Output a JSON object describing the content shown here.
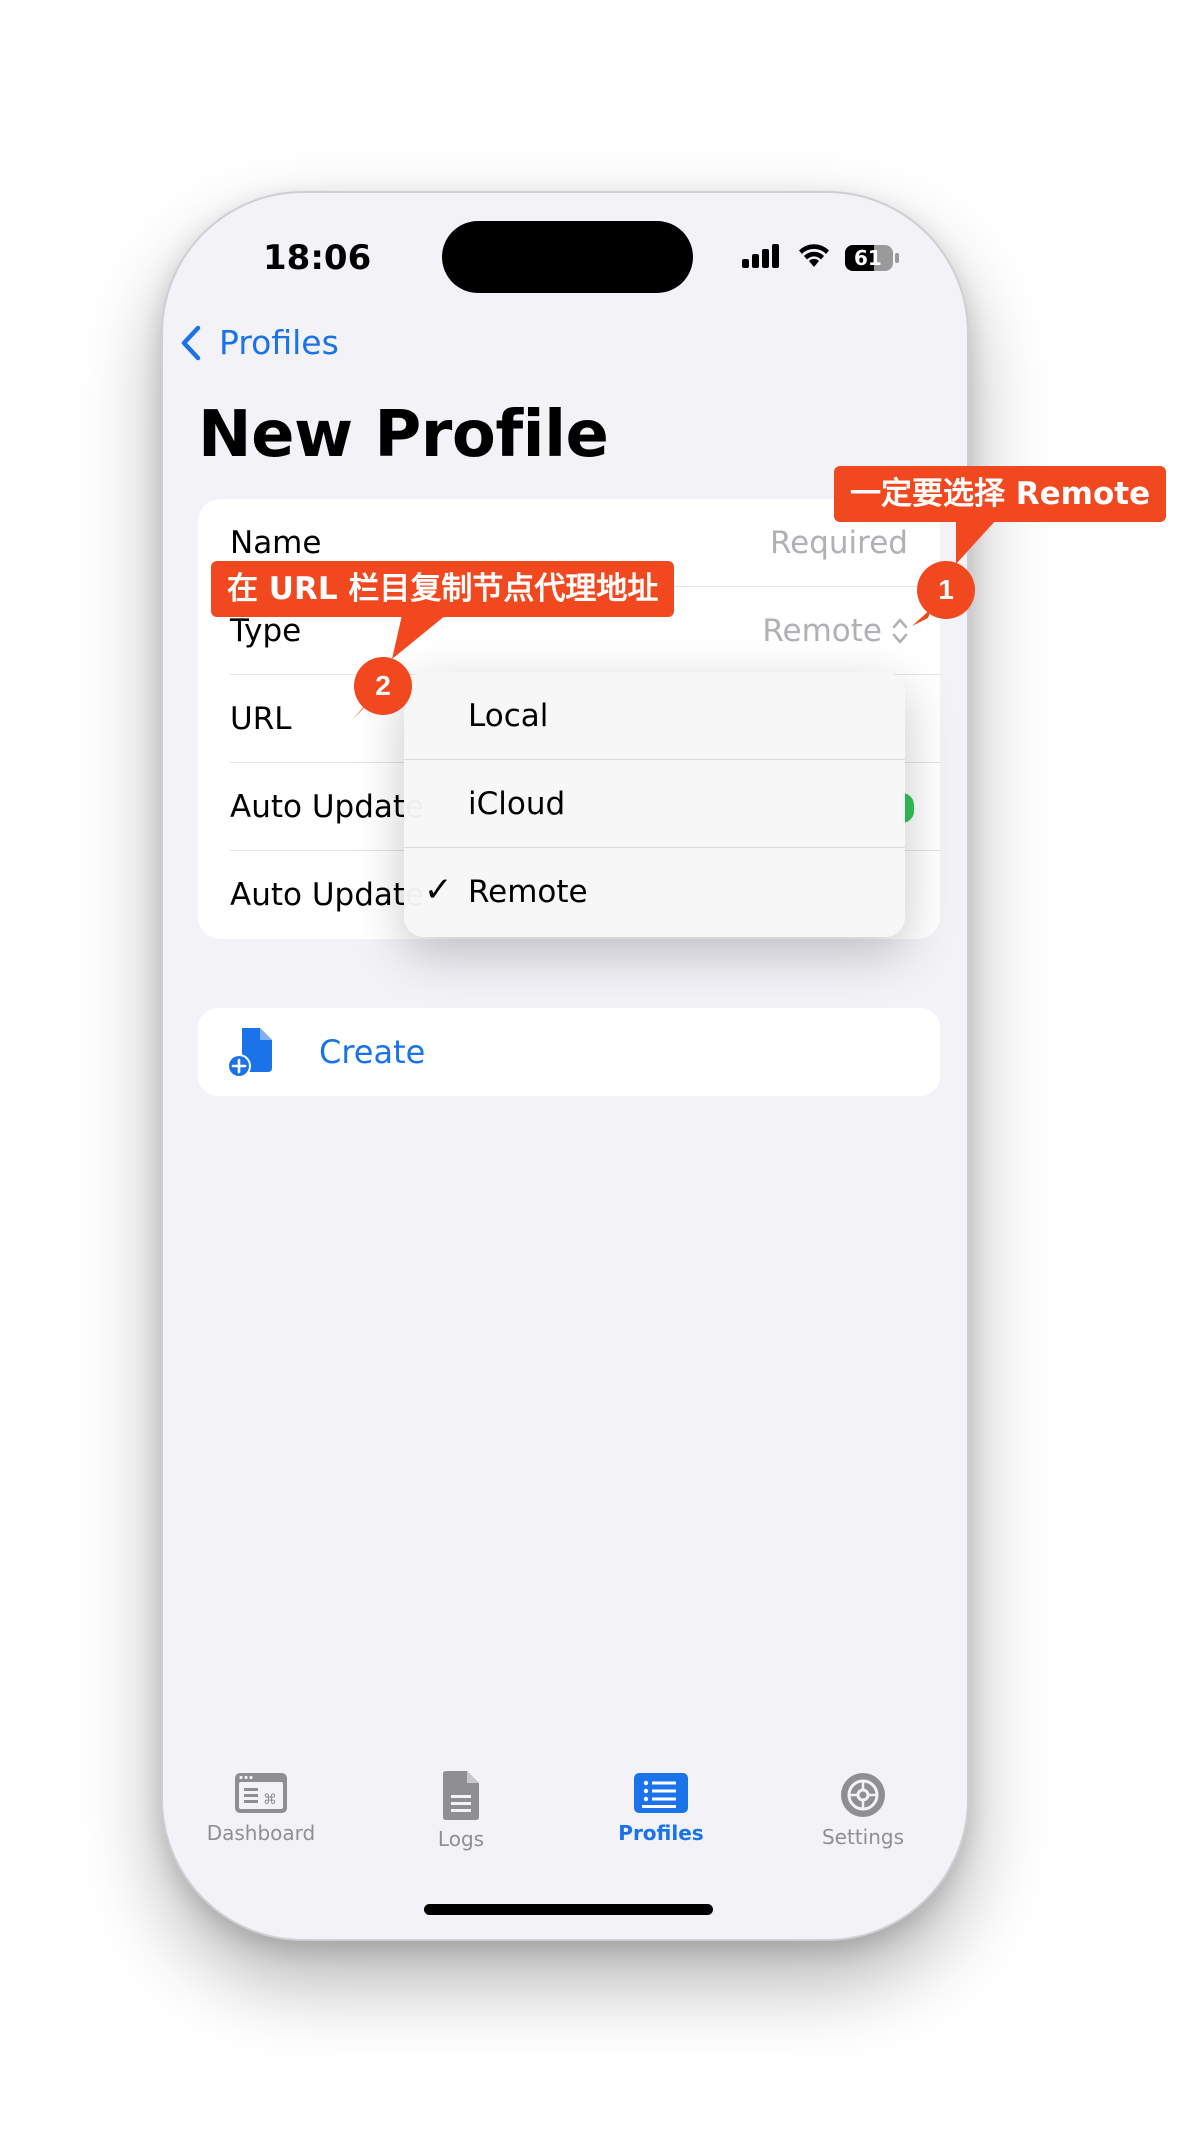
{
  "status": {
    "time": "18:06",
    "battery_percent": 61,
    "battery_label": "61"
  },
  "nav": {
    "back_label": "Profiles",
    "title": "New Profile"
  },
  "form": {
    "name_label": "Name",
    "name_placeholder": "Required",
    "type_label": "Type",
    "type_value": "Remote",
    "url_label": "URL",
    "auto_update_label": "Auto Update",
    "auto_update_interval_label": "Auto Update"
  },
  "type_menu": {
    "options": [
      "Local",
      "iCloud",
      "Remote"
    ],
    "selected": "Remote",
    "checkmark": "✓"
  },
  "create": {
    "label": "Create"
  },
  "tabs": [
    {
      "label": "Dashboard",
      "icon": "dashboard-icon"
    },
    {
      "label": "Logs",
      "icon": "logs-icon"
    },
    {
      "label": "Profiles",
      "icon": "profiles-icon",
      "active": true
    },
    {
      "label": "Settings",
      "icon": "settings-icon"
    }
  ],
  "annotations": {
    "note1_text": "一定要选择 Remote",
    "note1_number": "1",
    "note2_text": "在 URL 栏目复制节点代理地址",
    "note2_number": "2"
  },
  "colors": {
    "accent": "#1a73e8",
    "annotation": "#f2481f",
    "toggle_on": "#34c759",
    "background": "#f2f2f7"
  }
}
